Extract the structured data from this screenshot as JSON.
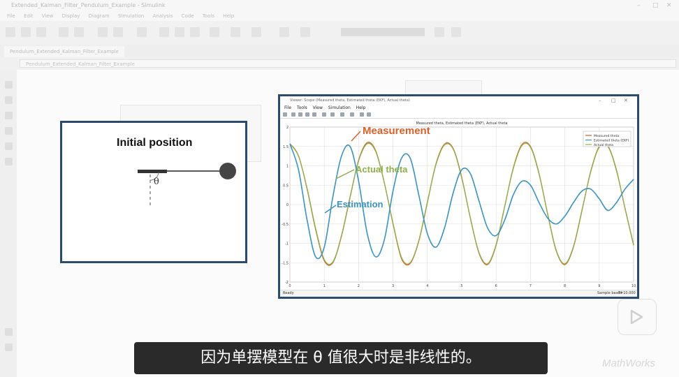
{
  "app": {
    "title": "Simulink",
    "window_title": "Extended_Kalman_Filter_Pendulum_Example - Simulink",
    "menus": [
      "File",
      "Edit",
      "View",
      "Display",
      "Diagram",
      "Simulation",
      "Analysis",
      "Code",
      "Tools",
      "Help"
    ],
    "tab_label": "Pendulum_Extended_Kalman_Filter_Example",
    "address": "Pendulum_Extended_Kalman_Filter_Example"
  },
  "initial_position": {
    "title": "Initial position",
    "angle_symbol": "θ"
  },
  "scope": {
    "window_title": "Viewer: Scope (Measured theta, Estimated theta (EKF), Actual theta)",
    "menus": [
      "File",
      "Tools",
      "View",
      "Simulation",
      "Help"
    ],
    "plot_title": "Measured theta, Estimated theta (EKF), Actual theta",
    "status_left": "Ready",
    "status_right_1": "Sample based",
    "status_right_2": "T=10.000",
    "annotations": {
      "measurement": "Measurement",
      "actual": "Actual theta",
      "estimation": "Estimation"
    }
  },
  "colors": {
    "measurement": "#d9622b",
    "actual": "#8db04a",
    "estimation": "#3a93c3",
    "frame": "#2c4a6e"
  },
  "subtitle": "因为单摆模型在 θ 值很大时是非线性的。",
  "watermark": "MathWorks",
  "chart_data": {
    "type": "line",
    "title": "Measured theta, Estimated theta (EKF), Actual theta",
    "xlim": [
      0,
      10
    ],
    "ylim": [
      -2,
      2
    ],
    "x_ticks": [
      "0",
      "1",
      "2",
      "3",
      "4",
      "5",
      "6",
      "7",
      "8",
      "9",
      "10"
    ],
    "y_ticks": [
      "2",
      "1.5",
      "1",
      "0.5",
      "0",
      "-0.5",
      "-1",
      "-1.5",
      "-2"
    ],
    "grid": true,
    "legend_position": "top-right",
    "legend": [
      "Measured theta",
      "Estimated theta (EKF)",
      "Actual theta"
    ],
    "x": [
      0,
      0.25,
      0.5,
      0.75,
      1,
      1.25,
      1.5,
      1.75,
      2,
      2.25,
      2.5,
      2.75,
      3,
      3.25,
      3.5,
      3.75,
      4,
      4.25,
      4.5,
      4.75,
      5,
      5.25,
      5.5,
      5.75,
      6,
      6.25,
      6.5,
      6.75,
      7,
      7.25,
      7.5,
      7.75,
      8,
      8.25,
      8.5,
      8.75,
      9,
      9.25,
      9.5,
      9.75,
      10
    ],
    "series": [
      {
        "name": "Measured theta",
        "color": "#d9622b",
        "values": [
          1.57,
          1.26,
          0.4,
          -0.65,
          -1.45,
          -1.5,
          -0.82,
          0.18,
          1.15,
          1.6,
          1.38,
          0.55,
          -0.5,
          -1.4,
          -1.52,
          -0.95,
          0.05,
          1.05,
          1.56,
          1.45,
          0.7,
          -0.35,
          -1.25,
          -1.55,
          -1.05,
          -0.05,
          0.95,
          1.55,
          1.5,
          0.8,
          -0.25,
          -1.2,
          -1.55,
          -1.1,
          -0.15,
          0.85,
          1.5,
          1.52,
          0.9,
          -0.1,
          -1.05
        ]
      },
      {
        "name": "Estimated theta (EKF)",
        "color": "#3a93c3",
        "values": [
          1.57,
          0.9,
          -0.4,
          -1.35,
          -1.1,
          0.2,
          1.25,
          1.5,
          0.6,
          -0.75,
          -1.35,
          -0.9,
          0.35,
          1.2,
          1.2,
          0.25,
          -0.75,
          -1.1,
          -0.6,
          0.3,
          0.9,
          0.8,
          0.1,
          -0.6,
          -0.8,
          -0.4,
          0.25,
          0.6,
          0.5,
          0.05,
          -0.35,
          -0.5,
          -0.3,
          0.05,
          0.35,
          0.4,
          0.15,
          -0.15,
          0.05,
          0.4,
          0.65
        ]
      },
      {
        "name": "Actual theta",
        "color": "#8db04a",
        "values": [
          1.57,
          1.25,
          0.42,
          -0.62,
          -1.42,
          -1.48,
          -0.8,
          0.2,
          1.13,
          1.57,
          1.36,
          0.55,
          -0.48,
          -1.37,
          -1.5,
          -0.93,
          0.07,
          1.03,
          1.54,
          1.43,
          0.68,
          -0.34,
          -1.23,
          -1.53,
          -1.03,
          -0.04,
          0.93,
          1.52,
          1.48,
          0.78,
          -0.24,
          -1.18,
          -1.53,
          -1.08,
          -0.13,
          0.83,
          1.48,
          1.5,
          0.88,
          -0.09,
          -1.03
        ]
      }
    ]
  }
}
